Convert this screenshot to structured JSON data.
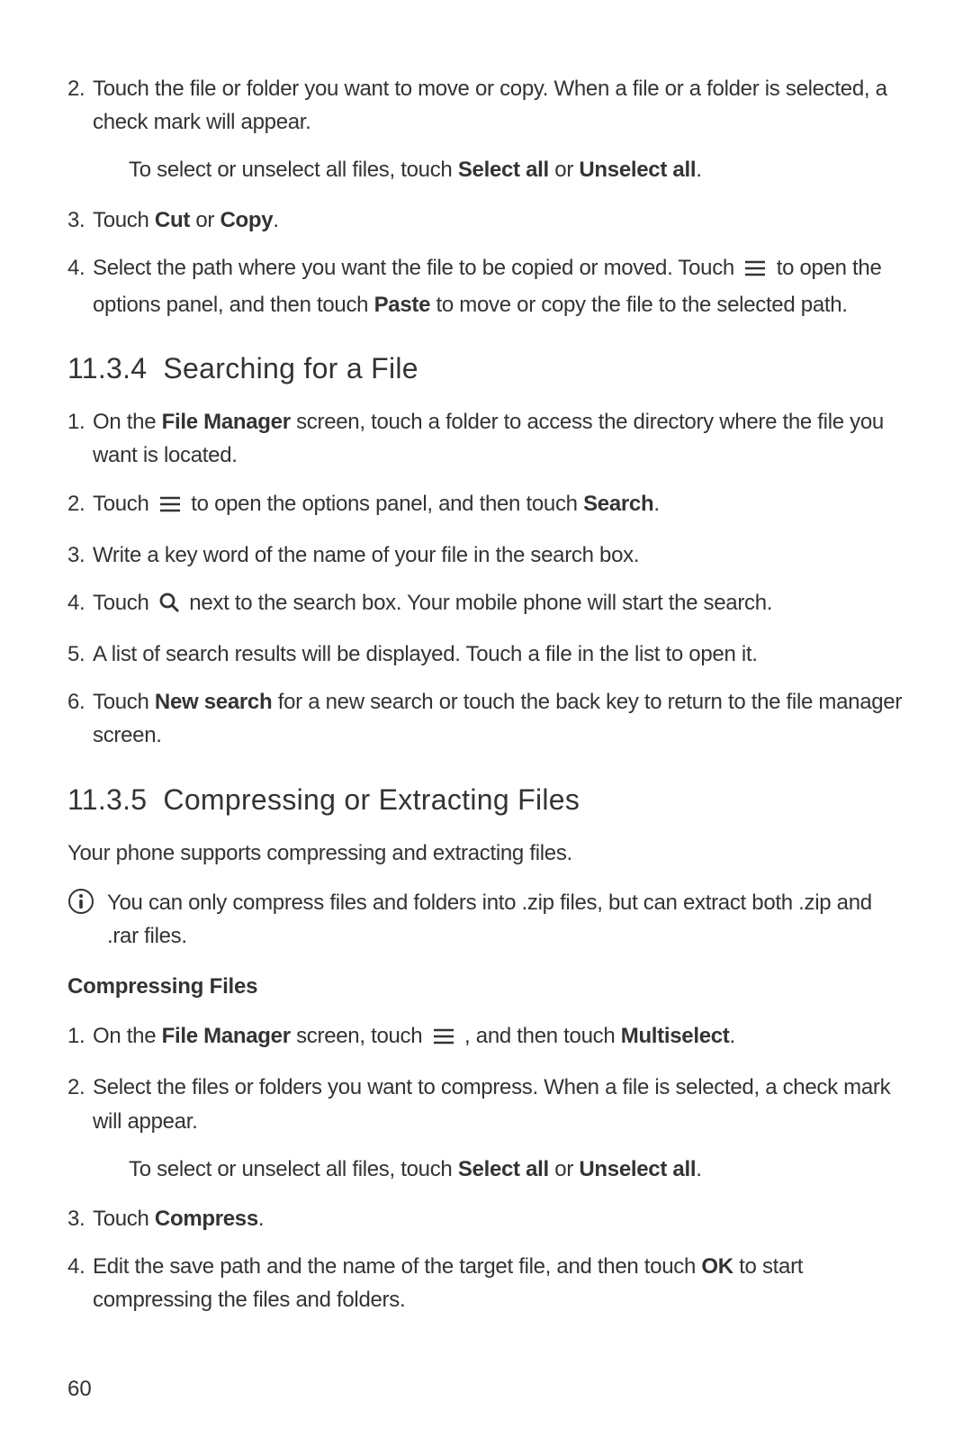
{
  "intro_steps": {
    "s2_num": "2.",
    "s2_a": "Touch the file or folder you want to move or copy. When a file or a folder is selected, a check mark will appear.",
    "s2_sub_a": "To select or unselect all files, touch ",
    "s2_sub_b1": "Select all",
    "s2_sub_mid": " or ",
    "s2_sub_b2": "Unselect all",
    "s2_sub_end": ".",
    "s3_num": "3.",
    "s3_a": "Touch ",
    "s3_b1": "Cut",
    "s3_mid": " or ",
    "s3_b2": "Copy",
    "s3_end": ".",
    "s4_num": "4.",
    "s4_a": "Select the path where you want the file to be copied or moved. Touch ",
    "s4_b": " to open the options panel, and then touch ",
    "s4_bold": "Paste",
    "s4_c": " to move or copy the file to the selected path."
  },
  "sec_1134": {
    "num": "11.3.4",
    "title": "Searching for a File",
    "s1_num": "1.",
    "s1_a": "On the ",
    "s1_b": "File Manager",
    "s1_c": " screen, touch a folder to access the directory where the file you want is located.",
    "s2_num": "2.",
    "s2_a": "Touch ",
    "s2_b": " to open the options panel, and then touch ",
    "s2_bold": "Search",
    "s2_end": ".",
    "s3_num": "3.",
    "s3_a": "Write a key word of the name of your file in the search box.",
    "s4_num": "4.",
    "s4_a": "Touch ",
    "s4_b": " next to the search box. Your mobile phone will start the search.",
    "s5_num": "5.",
    "s5_a": "A list of search results will be displayed. Touch a file in the list to open it.",
    "s6_num": "6.",
    "s6_a": "Touch ",
    "s6_bold": "New search",
    "s6_b": " for a new search or touch the back key to return to the file manager screen."
  },
  "sec_1135": {
    "num": "11.3.5",
    "title": "Compressing or Extracting Files",
    "intro": "Your phone supports compressing and extracting files.",
    "note": "You can only compress files and folders into .zip files, but can extract both .zip and .rar files.",
    "subhead": "Compressing Files",
    "s1_num": "1.",
    "s1_a": "On the ",
    "s1_b": "File Manager",
    "s1_c": " screen, touch ",
    "s1_d": " , and then touch ",
    "s1_bold": "Multiselect",
    "s1_end": ".",
    "s2_num": "2.",
    "s2_a": "Select the files or folders you want to compress. When a file is selected, a check mark will appear.",
    "s2_sub_a": "To select or unselect all files, touch ",
    "s2_sub_b1": "Select all",
    "s2_sub_mid": " or ",
    "s2_sub_b2": "Unselect all",
    "s2_sub_end": ".",
    "s3_num": "3.",
    "s3_a": "Touch ",
    "s3_bold": "Compress",
    "s3_end": ".",
    "s4_num": "4.",
    "s4_a": "Edit the save path and the name of the target file, and then touch ",
    "s4_bold": "OK",
    "s4_b": " to start compressing the files and folders."
  },
  "page_number": "60"
}
